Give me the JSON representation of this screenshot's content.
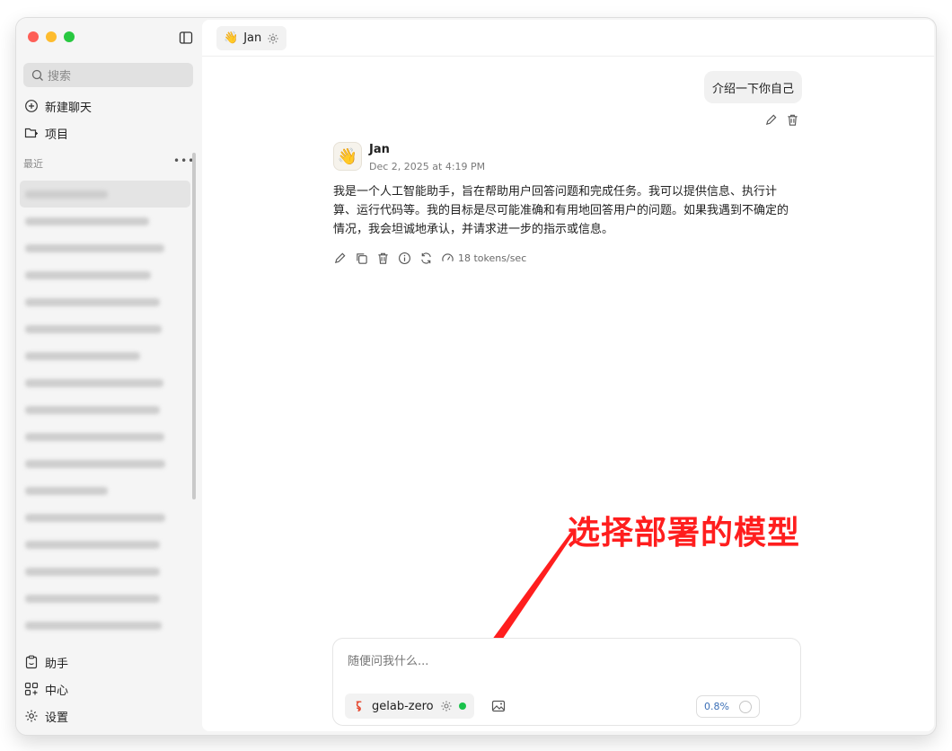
{
  "sidebar": {
    "search_placeholder": "搜索",
    "new_chat": "新建聊天",
    "projects": "项目",
    "recent_label": "最近",
    "recent_more": "•••",
    "bottom": {
      "assistant": "助手",
      "hub": "中心",
      "settings": "设置"
    }
  },
  "topbar": {
    "assistant_emoji": "👋",
    "assistant_name": "Jan"
  },
  "chat": {
    "user_message": "介绍一下你自己",
    "bot": {
      "avatar": "👋",
      "name": "Jan",
      "time": "Dec 2, 2025 at 4:19 PM",
      "lines": [
        "我是一个人工智能助手，旨在帮助用户回答问题和完成任务。我可以提供信息、执行计",
        "算、运行代码等。我的目标是尽可能准确和有用地回答用户的问题。如果我遇到不确定的",
        "情况，我会坦诚地承认，并请求进一步的指示或信息。"
      ],
      "tokens": "18 tokens/sec"
    }
  },
  "annotation": {
    "text": "选择部署的模型",
    "color": "#ff1e1e"
  },
  "composer": {
    "placeholder": "随便问我什么...",
    "model_name": "gelab-zero",
    "context_usage": "0.8%",
    "status_color": "#19c24b"
  }
}
